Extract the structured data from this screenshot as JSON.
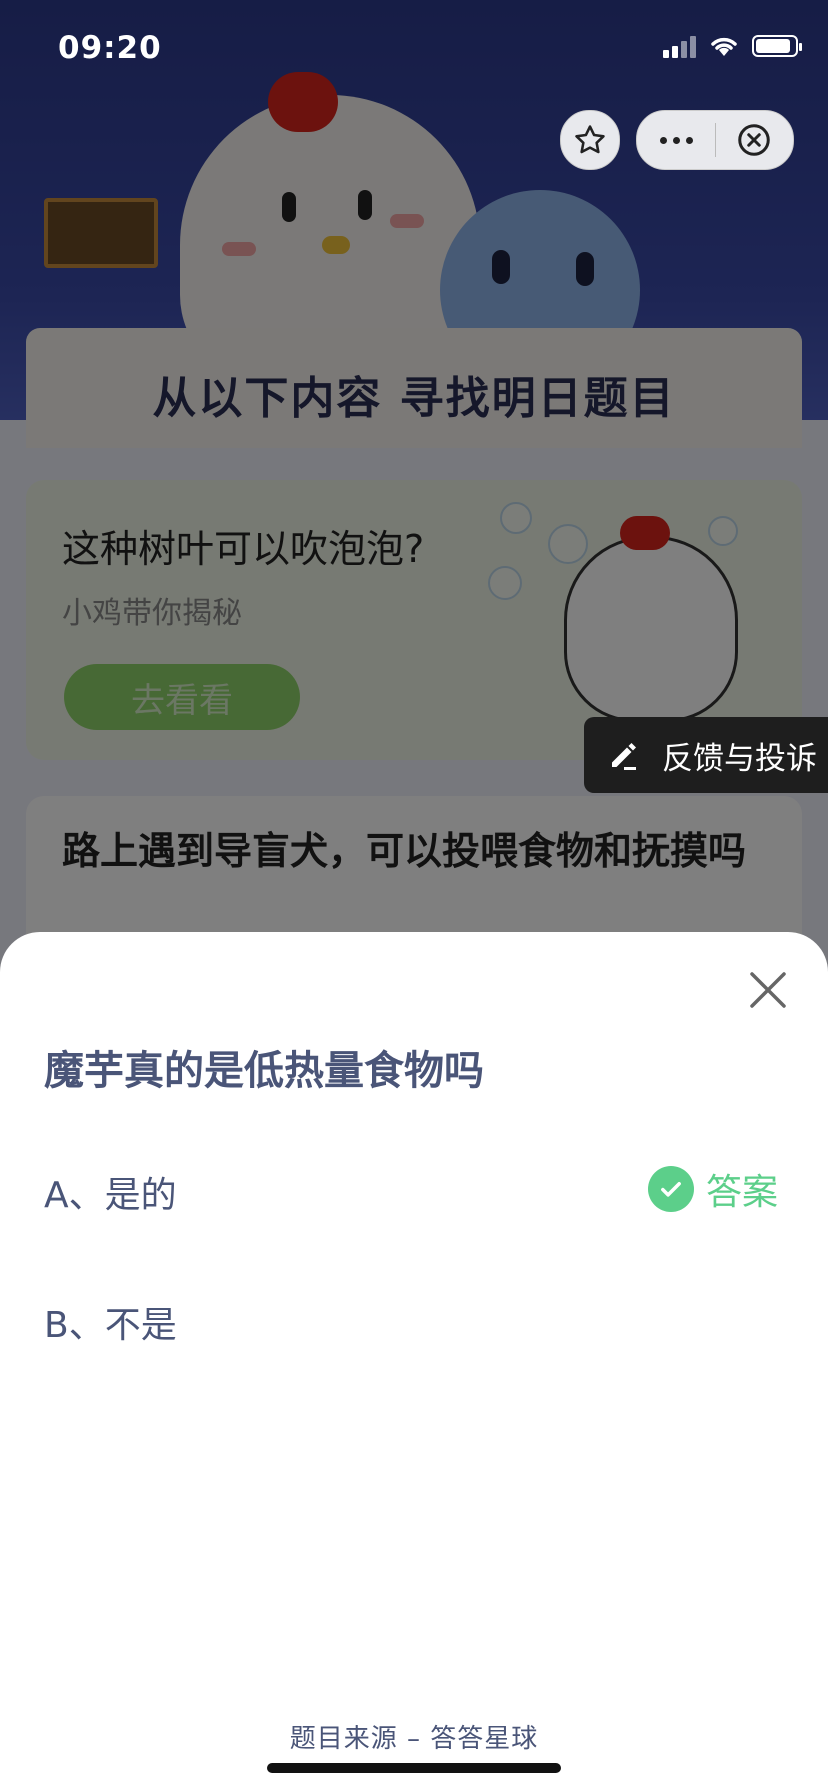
{
  "status_bar": {
    "time": "09:20"
  },
  "capsule": {
    "favorite_icon": "star-icon",
    "more_icon": "ellipsis-icon",
    "close_icon": "circle-x-icon"
  },
  "background": {
    "hero_title": "从以下内容 寻找明日题目",
    "card1": {
      "title": "这种树叶可以吹泡泡?",
      "subtitle": "小鸡带你揭秘",
      "button": "去看看"
    },
    "card2": {
      "title": "路上遇到导盲犬，可以投喂食物和抚摸吗"
    },
    "feedback": {
      "label": "反馈与投诉",
      "icon": "edit-icon"
    }
  },
  "sheet": {
    "question": "魔芋真的是低热量食物吗",
    "options": [
      {
        "label": "A、是的",
        "is_answer": true
      },
      {
        "label": "B、不是",
        "is_answer": false
      }
    ],
    "answer_label": "答案",
    "source": "题目来源 – 答答星球",
    "colors": {
      "answer": "#5ccf8a",
      "text": "#4a5578"
    }
  }
}
